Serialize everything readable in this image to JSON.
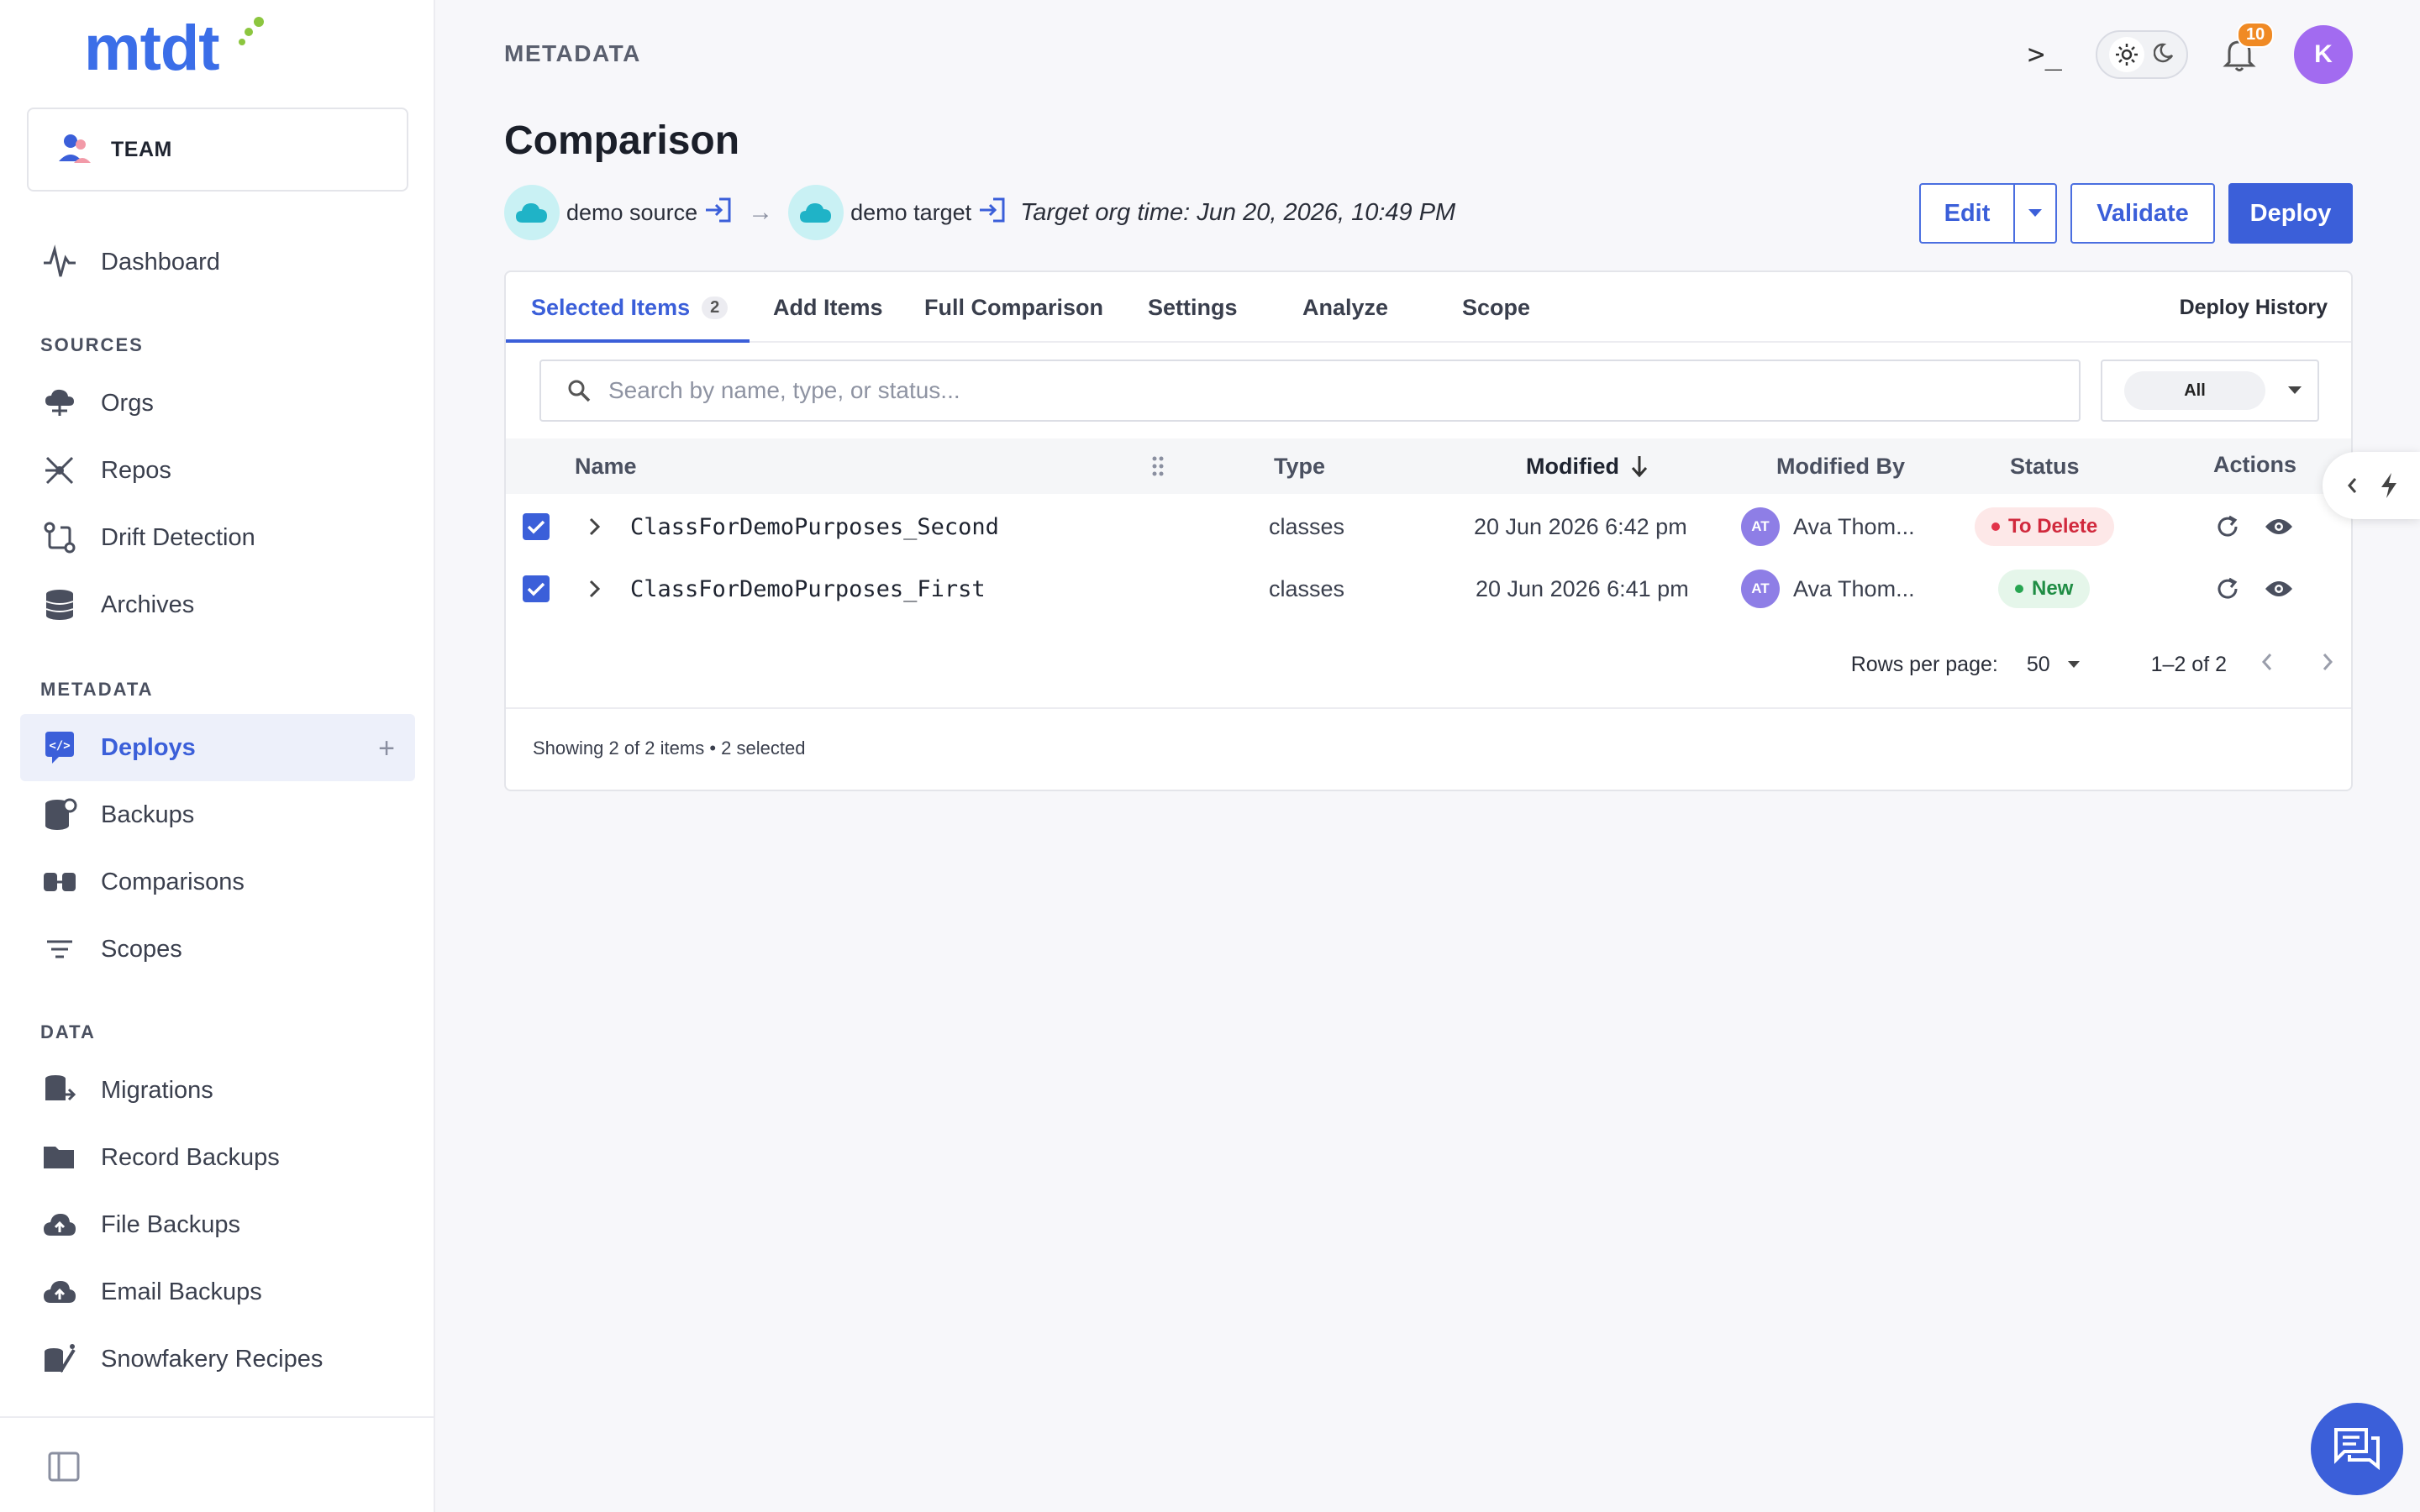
{
  "app": {
    "logo_text": "mtdt"
  },
  "sidebar": {
    "team_label": "TEAM",
    "dashboard": "Dashboard",
    "sections": {
      "sources": "SOURCES",
      "metadata": "METADATA",
      "data": "DATA"
    },
    "sources_items": [
      "Orgs",
      "Repos",
      "Drift Detection",
      "Archives"
    ],
    "metadata_items": [
      "Deploys",
      "Backups",
      "Comparisons",
      "Scopes"
    ],
    "data_items": [
      "Migrations",
      "Record Backups",
      "File Backups",
      "Email Backups",
      "Snowfakery Recipes"
    ],
    "active_item": "Deploys"
  },
  "header": {
    "breadcrumb": "METADATA",
    "notification_count": "10",
    "user_initial": "K"
  },
  "page": {
    "title": "Comparison",
    "source_org": "demo source",
    "target_org": "demo target",
    "org_time": "Target org time: Jun 20, 2026, 10:49 PM",
    "buttons": {
      "edit": "Edit",
      "validate": "Validate",
      "deploy": "Deploy"
    }
  },
  "tabs": {
    "selected": "Selected Items",
    "selected_count": "2",
    "add": "Add Items",
    "full": "Full Comparison",
    "settings": "Settings",
    "analyze": "Analyze",
    "scope": "Scope",
    "history": "Deploy History"
  },
  "search": {
    "placeholder": "Search by name, type, or status...",
    "filter_value": "All"
  },
  "table": {
    "headers": {
      "name": "Name",
      "type": "Type",
      "modified": "Modified",
      "modified_by": "Modified By",
      "status": "Status",
      "actions": "Actions"
    },
    "rows": [
      {
        "name": "ClassForDemoPurposes_Second",
        "type": "classes",
        "modified": "20 Jun 2026 6:42 pm",
        "initials": "AT",
        "modified_by": "Ava Thom...",
        "status": "To Delete"
      },
      {
        "name": "ClassForDemoPurposes_First",
        "type": "classes",
        "modified": "20 Jun 2026 6:41 pm",
        "initials": "AT",
        "modified_by": "Ava Thom...",
        "status": "New"
      }
    ]
  },
  "pagination": {
    "rows_label": "Rows per page:",
    "rows_value": "50",
    "range": "1–2 of 2"
  },
  "footer": {
    "summary": "Showing 2 of 2 items • 2 selected"
  },
  "colors": {
    "accent": "#3b5fd9",
    "logo": "#3b6ee8",
    "delete": "#d1293d",
    "new": "#1f8d44"
  }
}
